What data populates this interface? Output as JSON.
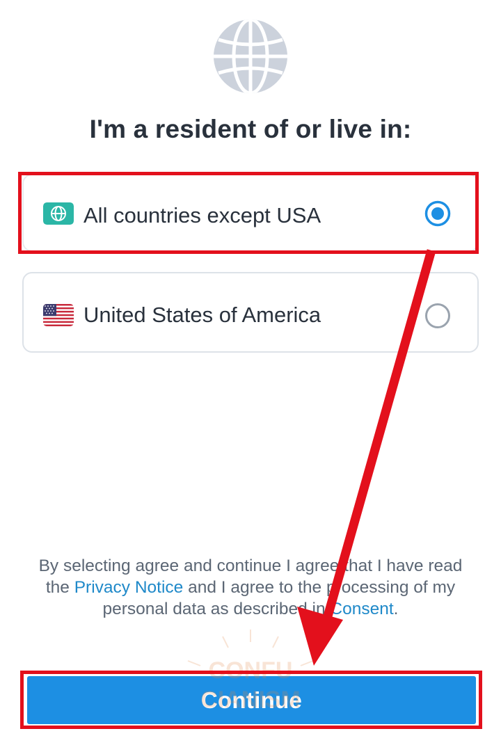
{
  "header": {
    "icon": "globe-icon",
    "title": "I'm a resident of or live in:"
  },
  "options": [
    {
      "label": "All countries except USA",
      "icon": "globe-icon",
      "selected": true
    },
    {
      "label": "United States of America",
      "icon": "us-flag-icon",
      "selected": false
    }
  ],
  "consent": {
    "part1": "By selecting agree and continue I agree that I have read the ",
    "privacy_link": "Privacy Notice",
    "part2": " and I agree to the processing of my personal data as described in ",
    "consent_link": "Consent",
    "part3": "."
  },
  "continue_button": {
    "label": "Continue"
  },
  "watermark": {
    "line1": "CONFU",
    "line2": "CIANISM"
  },
  "colors": {
    "accent": "#1d8fe3",
    "link": "#1f89c9",
    "annotation_red": "#e3101c",
    "globe_badge": "#2bb6a6"
  }
}
